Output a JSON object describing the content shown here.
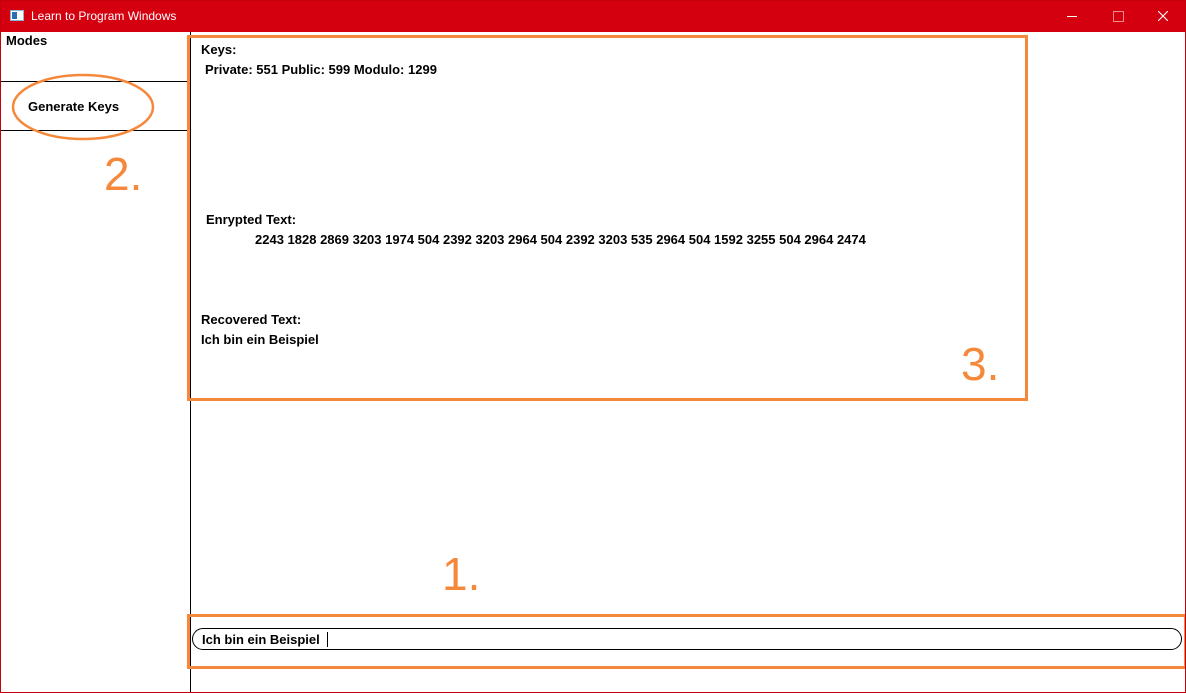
{
  "window": {
    "title": "Learn to Program Windows",
    "icon": "app-window-icon",
    "controls": [
      "minimize-icon",
      "maximize-icon",
      "close-icon"
    ]
  },
  "sidebar": {
    "modes_label": "Modes",
    "generate_keys_label": "Generate Keys"
  },
  "output": {
    "keys_heading": "Keys:",
    "keys_value": "Private: 551 Public: 599 Modulo: 1299",
    "encrypted_heading": "Enrypted Text:",
    "encrypted_value": "2243 1828 2869 3203 1974 504 2392 3203 2964 504 2392 3203 535 2964 504 1592 3255 504 2964 2474",
    "recovered_heading": "Recovered Text:",
    "recovered_value": "Ich bin ein Beispiel"
  },
  "input": {
    "value": "Ich bin ein Beispiel"
  },
  "annotations": {
    "color": "#f5883a",
    "input_marker": "1.",
    "sidebar_marker": "2.",
    "output_marker": "3."
  },
  "colors": {
    "titlebar": "#d40010",
    "annotation": "#f5883a"
  }
}
